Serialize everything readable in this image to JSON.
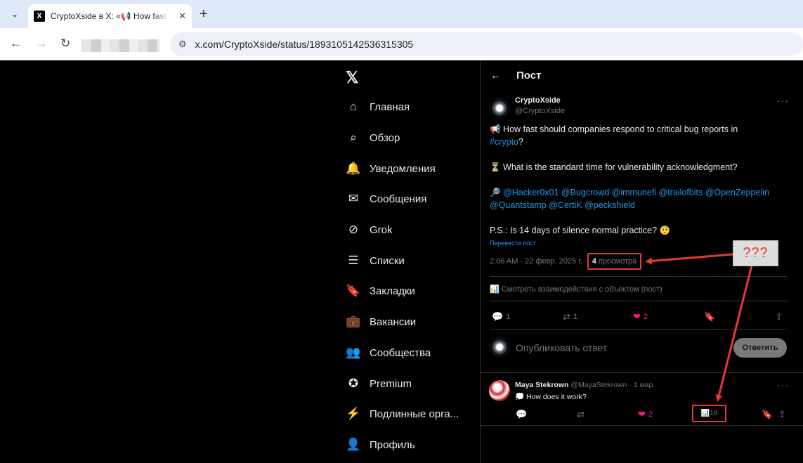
{
  "browser": {
    "tab_title": "CryptoXside в X: «📢 How fast should companies respond",
    "tab_favicon": "X",
    "new_tab": "+",
    "url": "x.com/CryptoXside/status/1893105142536315305",
    "icons": {
      "back": "←",
      "forward": "→",
      "reload": "↻",
      "site_info": "⚙",
      "tab_menu": "⌄",
      "tab_close": "✕"
    }
  },
  "sidebar": {
    "logo": "𝕏",
    "items": [
      {
        "label": "Главная",
        "icon": "⌂",
        "icon_name": "home-icon"
      },
      {
        "label": "Обзор",
        "icon": "⌕",
        "icon_name": "search-icon"
      },
      {
        "label": "Уведомления",
        "icon": "🔔",
        "icon_name": "bell-icon"
      },
      {
        "label": "Сообщения",
        "icon": "✉",
        "icon_name": "mail-icon"
      },
      {
        "label": "Grok",
        "icon": "⊘",
        "icon_name": "grok-icon"
      },
      {
        "label": "Списки",
        "icon": "☰",
        "icon_name": "lists-icon"
      },
      {
        "label": "Закладки",
        "icon": "🔖",
        "icon_name": "bookmark-icon"
      },
      {
        "label": "Вакансии",
        "icon": "💼",
        "icon_name": "briefcase-icon"
      },
      {
        "label": "Сообщества",
        "icon": "👥",
        "icon_name": "communities-icon"
      },
      {
        "label": "Premium",
        "icon": "✪",
        "icon_name": "premium-icon"
      },
      {
        "label": "Подлинные орга...",
        "icon": "⚡",
        "icon_name": "lightning-icon"
      },
      {
        "label": "Профиль",
        "icon": "👤",
        "icon_name": "profile-icon"
      }
    ]
  },
  "post": {
    "header_title": "Пост",
    "back_icon": "←",
    "author_name": "CryptoXside",
    "author_handle": "@CryptoXside",
    "more_icon": "···",
    "line1_a": "📢 How fast should companies respond to critical bug reports in",
    "line1_b_link": "#crypto",
    "line1_b_tail": "?",
    "line2": "⏳ What is the standard time for vulnerability acknowledgment?",
    "line3_icon": "🔎",
    "line3_links": "@Hacker0x01 @Bugcrowd @immunefi @trailofbits @OpenZeppelin",
    "line4_links": "@Quantstamp @CertiK @peckshield",
    "line5": "P.S.: Is 14 days of silence normal practice? 🤨",
    "translate": "Перевести пост",
    "timestamp": "2:06 AM · 22 февр. 2025 г. ·",
    "views_count": "4",
    "views_label": "просмотра",
    "engagements": "Смотреть взаимодействия с объектом (пост)",
    "engagements_icon": "📊",
    "actions": {
      "reply_count": "1",
      "repost_count": "1",
      "like_count": "2",
      "reply_icon": "💬",
      "repost_icon": "⇄",
      "like_icon": "❤",
      "bookmark_icon": "🔖",
      "share_icon": "⇪"
    },
    "reply_placeholder": "Опубликовать ответ",
    "reply_button": "Ответить"
  },
  "reply_post": {
    "author_name": "Maya Stekrown",
    "meta": "@MayaStekrown · 1 мар.",
    "text": "💭 How does it work?",
    "like_count": "2",
    "views_count": "18",
    "stats_icon": "📊"
  },
  "annotation": {
    "callout_text": "???",
    "color": "#e53935"
  }
}
